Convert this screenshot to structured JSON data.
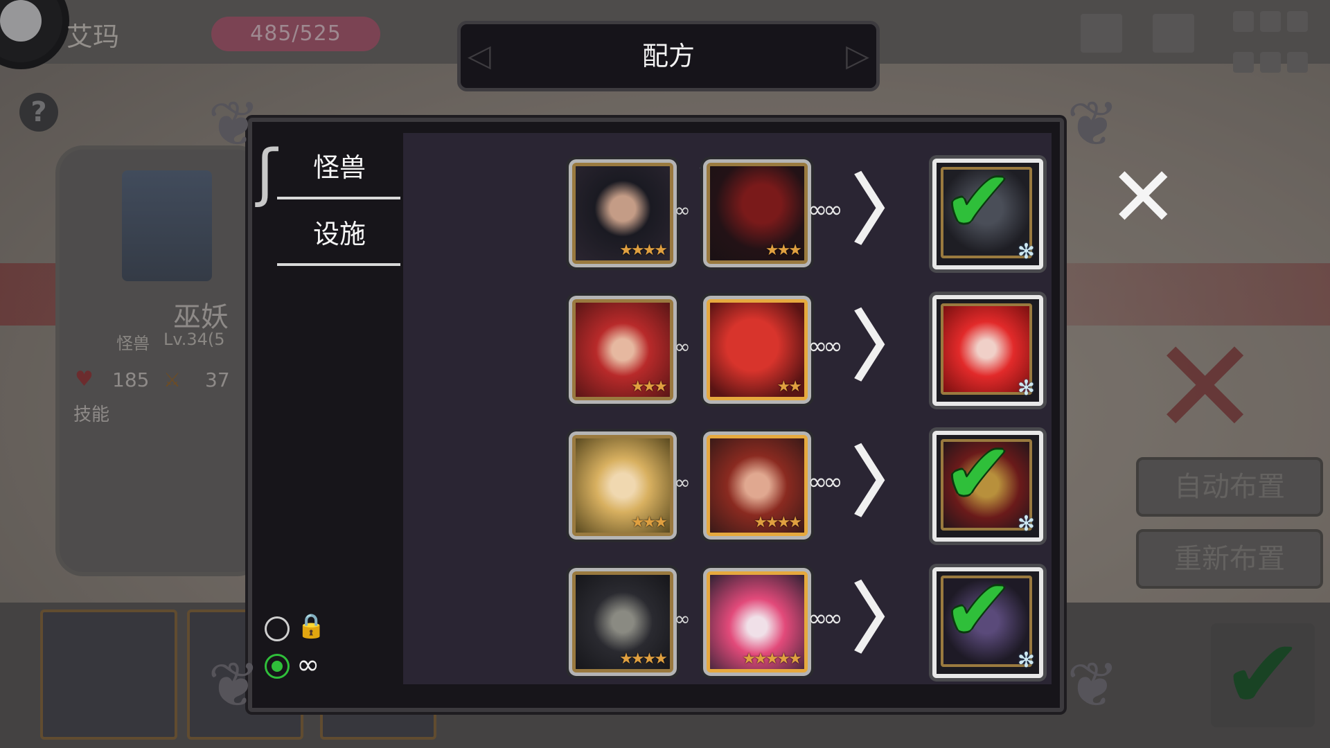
{
  "header": {
    "player_name": "艾玛",
    "hp_text": "485/525",
    "help_icon_glyph": "?"
  },
  "unit": {
    "name": "巫妖",
    "type": "怪兽",
    "level_text": "Lv.34(5",
    "hp": "185",
    "attack": "37",
    "skills_label": "技能"
  },
  "side_buttons": {
    "auto_place": "自动布置",
    "reset_place": "重新布置"
  },
  "modal": {
    "title": "配方",
    "tabs": [
      {
        "label": "怪兽",
        "selected": true
      },
      {
        "label": "设施",
        "selected": false
      }
    ],
    "recipes": [
      {
        "ingredient_a": {
          "stars": 4,
          "art": "dark-hair-girl"
        },
        "ingredient_b": {
          "stars": 3,
          "art": "shadow-dragon"
        },
        "result": {
          "completed": true,
          "art": "dark-warrior"
        }
      },
      {
        "ingredient_a": {
          "stars": 3,
          "art": "red-hair-girl"
        },
        "ingredient_b": {
          "stars": 2,
          "art": "red-dragon"
        },
        "result": {
          "completed": false,
          "art": "red-hair-succubus"
        }
      },
      {
        "ingredient_a": {
          "stars": 3,
          "art": "blonde-rose-girl"
        },
        "ingredient_b": {
          "stars": 4,
          "art": "horned-warrior-girl"
        },
        "result": {
          "completed": true,
          "art": "rose-queen"
        }
      },
      {
        "ingredient_a": {
          "stars": 4,
          "art": "skeleton-reaper"
        },
        "ingredient_b": {
          "stars": 5,
          "art": "pink-hair-witch"
        },
        "result": {
          "completed": true,
          "art": "dark-mage"
        }
      }
    ],
    "filter": [
      {
        "selected": false,
        "icon": "lock-icon"
      },
      {
        "selected": true,
        "icon": "infinity-icon"
      }
    ],
    "star_glyph": "★",
    "check_glyph": "✔",
    "snow_glyph": "✻",
    "arrow_glyph": "〉",
    "close_glyph": "✕",
    "scroll_glyph": "︿"
  },
  "colors": {
    "modal_bg": "#2a2533",
    "check_green": "#2fbf3a",
    "hp_pill": "#b35c72",
    "gold_frame": "#9a7a3f"
  }
}
